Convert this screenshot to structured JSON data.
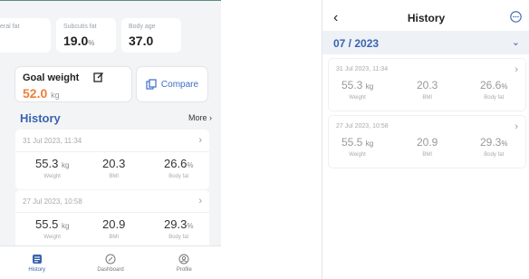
{
  "left": {
    "stats": [
      {
        "label": "eral fat",
        "value": "",
        "unit": ""
      },
      {
        "label": "Subcutis fat",
        "value": "19.0",
        "unit": "%"
      },
      {
        "label": "Body age",
        "value": "37.0",
        "unit": ""
      }
    ],
    "goal": {
      "title": "Goal weight",
      "value": "52.0",
      "unit": "kg"
    },
    "compare_label": "Compare",
    "history_title": "History",
    "more_label": "More",
    "records": [
      {
        "date": "31 Jul 2023, 11:34",
        "metrics": [
          {
            "value": "55.3",
            "unit": "kg",
            "label": "Weight"
          },
          {
            "value": "20.3",
            "unit": "",
            "label": "BMI"
          },
          {
            "value": "26.6",
            "unit": "%",
            "label": "Body fat"
          }
        ]
      },
      {
        "date": "27 Jul 2023, 10:58",
        "metrics": [
          {
            "value": "55.5",
            "unit": "kg",
            "label": "Weight"
          },
          {
            "value": "20.9",
            "unit": "",
            "label": "BMI"
          },
          {
            "value": "29.3",
            "unit": "%",
            "label": "Body fat"
          }
        ]
      }
    ],
    "tabs": [
      {
        "label": "History",
        "icon": "history-icon",
        "active": true
      },
      {
        "label": "Dashboard",
        "icon": "dashboard-icon",
        "active": false
      },
      {
        "label": "Profile",
        "icon": "profile-icon",
        "active": false
      }
    ]
  },
  "right": {
    "title": "History",
    "back_icon": "back-chevron-icon",
    "month": "07 / 2023",
    "records": [
      {
        "date": "31 Jul 2023, 11:34",
        "metrics": [
          {
            "value": "55.3",
            "unit": "kg",
            "label": "Weight"
          },
          {
            "value": "20.3",
            "unit": "",
            "label": "BMI"
          },
          {
            "value": "26.6",
            "unit": "%",
            "label": "Body fat"
          }
        ]
      },
      {
        "date": "27 Jul 2023, 10:58",
        "metrics": [
          {
            "value": "55.5",
            "unit": "kg",
            "label": "Weight"
          },
          {
            "value": "20.9",
            "unit": "",
            "label": "BMI"
          },
          {
            "value": "29.3",
            "unit": "%",
            "label": "Body fat"
          }
        ]
      }
    ]
  },
  "colors": {
    "accent": "#3a63b0",
    "goal": "#f0803a"
  }
}
